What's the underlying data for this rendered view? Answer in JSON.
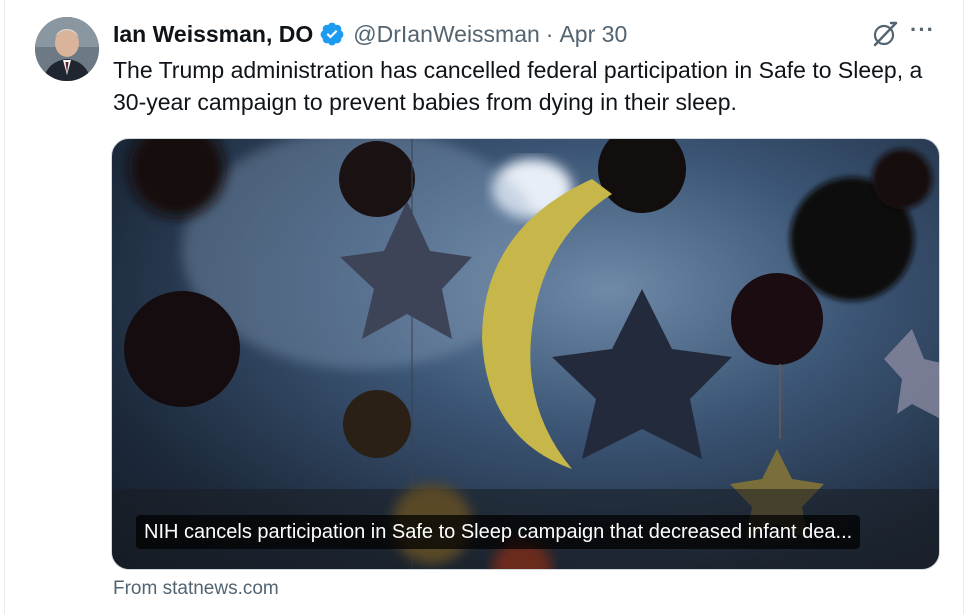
{
  "tweet": {
    "author_name": "Ian Weissman, DO",
    "handle": "@DrIanWeissman",
    "separator": "·",
    "date": "Apr 30",
    "text": "The Trump administration has cancelled federal participation in Safe to Sleep, a 30-year campaign to prevent babies from dying in their sleep.",
    "more_label": "···"
  },
  "link_card": {
    "headline": "NIH cancels participation in Safe to Sleep campaign that decreased infant dea...",
    "source": "From statnews.com"
  },
  "colors": {
    "verified": "#1d9bf0",
    "text_primary": "#0f1419",
    "text_secondary": "#536471"
  },
  "icons": [
    "verified-badge-icon",
    "grok-icon",
    "more-options-icon"
  ]
}
